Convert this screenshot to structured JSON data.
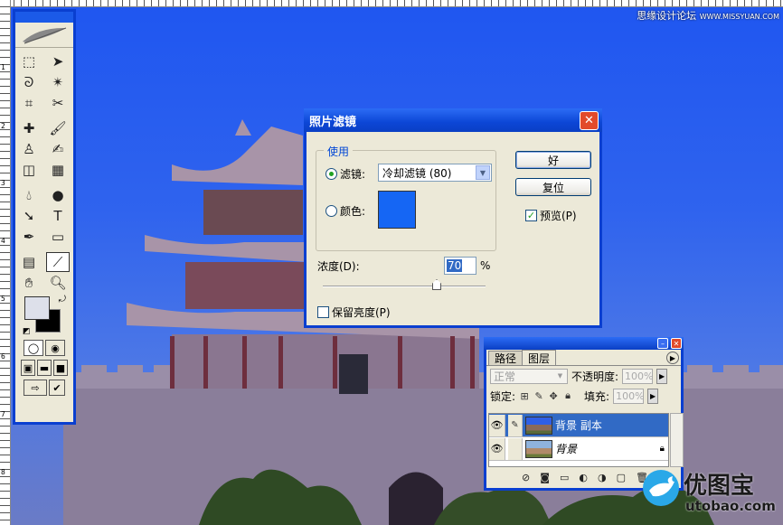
{
  "watermark_top": {
    "site_cn": "思缘设计论坛",
    "site_url": "WWW.MISSYUAN.COM"
  },
  "watermark_logo": {
    "name_cn": "优图宝",
    "url": "utobao.com"
  },
  "ruler": {
    "marks": [
      "1",
      "2",
      "3",
      "4",
      "5",
      "6",
      "7",
      "8"
    ]
  },
  "dialog": {
    "title": "照片滤镜",
    "use_group_label": "使用",
    "filter_radio_label": "滤镜:",
    "filter_value": "冷却滤镜 (80)",
    "color_radio_label": "颜色:",
    "color_value": "#1566f4",
    "density_label": "浓度(D):",
    "density_value": "70",
    "density_unit": "%",
    "density_fraction": 0.7,
    "preserve_luminosity_label": "保留亮度(P)",
    "preserve_luminosity_checked": false,
    "ok_label": "好",
    "reset_label": "复位",
    "preview_label": "预览(P)",
    "preview_checked": true,
    "selected_mode": "filter"
  },
  "layers_panel": {
    "tabs": [
      "路径",
      "图层"
    ],
    "active_tab": "图层",
    "blend_mode": "正常",
    "opacity_label": "不透明度:",
    "opacity_value": "100%",
    "lock_label": "锁定:",
    "fill_label": "填充:",
    "fill_value": "100%",
    "layers": [
      {
        "name": "背景 副本",
        "selected": true,
        "locked": false
      },
      {
        "name": "背景",
        "selected": false,
        "locked": true
      }
    ],
    "footer_icons": [
      "link-icon",
      "layer-style-icon",
      "mask-icon",
      "new-set-icon",
      "adjustment-icon",
      "new-layer-icon",
      "trash-icon"
    ]
  },
  "toolbox": {
    "tools": [
      "marquee-icon",
      "move-icon",
      "lasso-icon",
      "magic-wand-icon",
      "crop-icon",
      "slice-icon",
      "healing-brush-icon",
      "brush-icon",
      "clone-stamp-icon",
      "history-brush-icon",
      "eraser-icon",
      "gradient-icon",
      "blur-icon",
      "dodge-icon",
      "path-select-icon",
      "type-icon",
      "pen-icon",
      "shape-icon",
      "notes-icon",
      "eyedropper-icon",
      "hand-icon",
      "zoom-icon"
    ],
    "active_tool": "eyedropper-icon",
    "foreground_color": "#dde0ea",
    "background_color": "#000000"
  }
}
